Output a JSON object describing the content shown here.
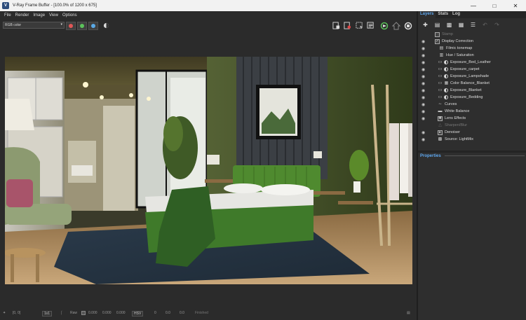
{
  "window": {
    "app_icon_glyph": "V",
    "title": "V-Ray Frame Buffer - [100.0% of 1200 x 675]",
    "controls": [
      "minimize-icon",
      "maximize-icon",
      "close-icon"
    ]
  },
  "menu": [
    "File",
    "Render",
    "Image",
    "View",
    "Options"
  ],
  "toolbar": {
    "channel_select": "RGB color",
    "channel_buttons": [
      {
        "name": "red-channel-icon",
        "color": "#e05757"
      },
      {
        "name": "green-channel-icon",
        "color": "#5bc25b"
      },
      {
        "name": "blue-channel-icon",
        "color": "#5aa9e6"
      }
    ],
    "right_icons": [
      "save-image-icon",
      "clear-image-icon",
      "region-render-icon",
      "track-mouse-icon",
      "render-icon",
      "interactive-render-icon",
      "stop-render-icon"
    ]
  },
  "layers_panel": {
    "tabs": [
      "Layers",
      "Stats",
      "Log"
    ],
    "active_tab": "Layers",
    "toolbar_icons": [
      "add-layer-icon",
      "save-layers-icon",
      "load-layers-icon",
      "save-preset-icon",
      "list-icon",
      "undo-icon",
      "redo-icon"
    ],
    "layers": [
      {
        "label": "Stamp",
        "visible": false,
        "dim": true,
        "indent": 1
      },
      {
        "label": "Display Correction",
        "visible": true,
        "dim": false,
        "indent": 1
      },
      {
        "label": "Filmic tonemap",
        "visible": true,
        "dim": false,
        "indent": 2
      },
      {
        "label": "Hue / Saturation",
        "visible": true,
        "dim": false,
        "indent": 2
      },
      {
        "label": "Exposure_Bed_Leather",
        "visible": true,
        "dim": false,
        "indent": 3
      },
      {
        "label": "Exposure_carpet",
        "visible": true,
        "dim": false,
        "indent": 3
      },
      {
        "label": "Exposure_Lampshade",
        "visible": true,
        "dim": false,
        "indent": 3
      },
      {
        "label": "Color Balance_Blanket",
        "visible": true,
        "dim": false,
        "indent": 3
      },
      {
        "label": "Exposure_Blanket",
        "visible": true,
        "dim": false,
        "indent": 3
      },
      {
        "label": "Exposure_Bedding",
        "visible": true,
        "dim": false,
        "indent": 3
      },
      {
        "label": "Curves",
        "visible": true,
        "dim": false,
        "indent": 2
      },
      {
        "label": "White Balance",
        "visible": true,
        "dim": false,
        "indent": 2
      },
      {
        "label": "Lens Effects",
        "visible": true,
        "dim": false,
        "indent": 2
      },
      {
        "label": "Sharpen/Blur",
        "visible": false,
        "dim": true,
        "indent": 2
      },
      {
        "label": "Denoiser",
        "visible": true,
        "dim": false,
        "indent": 2
      },
      {
        "label": "Source: LightMix",
        "visible": true,
        "dim": false,
        "indent": 2
      }
    ],
    "properties_label": "Properties"
  },
  "status": {
    "coords": "[0, 0]",
    "zoom": "1x1",
    "raw_label": "Raw",
    "values": [
      "0.000",
      "0.000",
      "0.000"
    ],
    "color_mode": "HSV",
    "hsv_values": [
      "0",
      "0.0",
      "0.0"
    ],
    "state": "Finished"
  }
}
